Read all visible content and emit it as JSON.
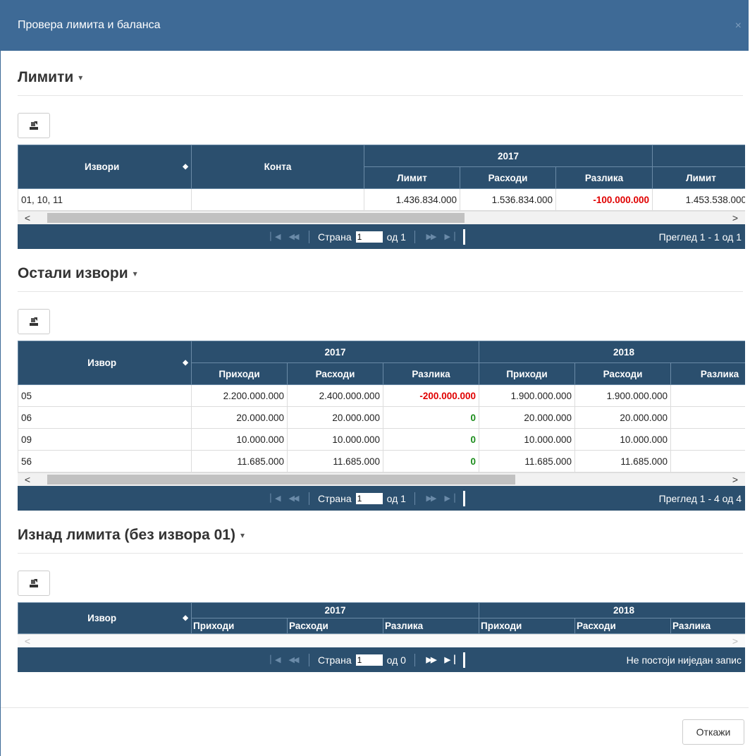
{
  "dialog": {
    "title": "Провера лимита и баланса",
    "close_glyph": "×"
  },
  "icons": {
    "export": "export-icon",
    "sort": "sort-icon",
    "caret": "caret-down-icon",
    "close": "close-icon"
  },
  "colors": {
    "header": "#2b4f6e",
    "titlebar": "#3e6a96",
    "negative": "#e00000",
    "zero": "#1a8c1a"
  },
  "limits": {
    "title": "Лимити",
    "headers": {
      "izvori": "Извори",
      "konta": "Конта",
      "year1": "2017",
      "limit": "Лимит",
      "rashodi": "Расходи",
      "razlika": "Разлика",
      "limit2": "Лимит"
    },
    "rows": [
      {
        "izvori": "01, 10, 11",
        "konta": "",
        "limit": "1.436.834.000",
        "rashodi": "1.536.834.000",
        "razlika": "-100.000.000",
        "limit2": "1.453.538.000"
      }
    ],
    "pager": {
      "page_label": "Страна",
      "page": "1",
      "of_label": "од 1",
      "info": "Преглед 1 - 1 од 1"
    }
  },
  "other": {
    "title": "Остали извори",
    "headers": {
      "izvor": "Извор",
      "year1": "2017",
      "year2": "2018",
      "prihodi": "Приходи",
      "rashodi": "Расходи",
      "razlika": "Разлика"
    },
    "rows": [
      {
        "izvor": "05",
        "p1": "2.200.000.000",
        "r1": "2.400.000.000",
        "d1": "-200.000.000",
        "p2": "1.900.000.000",
        "r2": "1.900.000.000"
      },
      {
        "izvor": "06",
        "p1": "20.000.000",
        "r1": "20.000.000",
        "d1": "0",
        "p2": "20.000.000",
        "r2": "20.000.000"
      },
      {
        "izvor": "09",
        "p1": "10.000.000",
        "r1": "10.000.000",
        "d1": "0",
        "p2": "10.000.000",
        "r2": "10.000.000"
      },
      {
        "izvor": "56",
        "p1": "11.685.000",
        "r1": "11.685.000",
        "d1": "0",
        "p2": "11.685.000",
        "r2": "11.685.000"
      }
    ],
    "pager": {
      "page_label": "Страна",
      "page": "1",
      "of_label": "од 1",
      "info": "Преглед 1 - 4 од 4"
    }
  },
  "over": {
    "title": "Изнад лимита (без извора 01)",
    "headers": {
      "izvor": "Извор",
      "year1": "2017",
      "year2": "2018",
      "prihodi": "Приходи",
      "rashodi": "Расходи",
      "razlika": "Разлика"
    },
    "pager": {
      "page_label": "Страна",
      "page": "1",
      "of_label": "од 0",
      "info": "Не постоји ниједан запис"
    }
  },
  "footer": {
    "cancel_label": "Откажи"
  }
}
